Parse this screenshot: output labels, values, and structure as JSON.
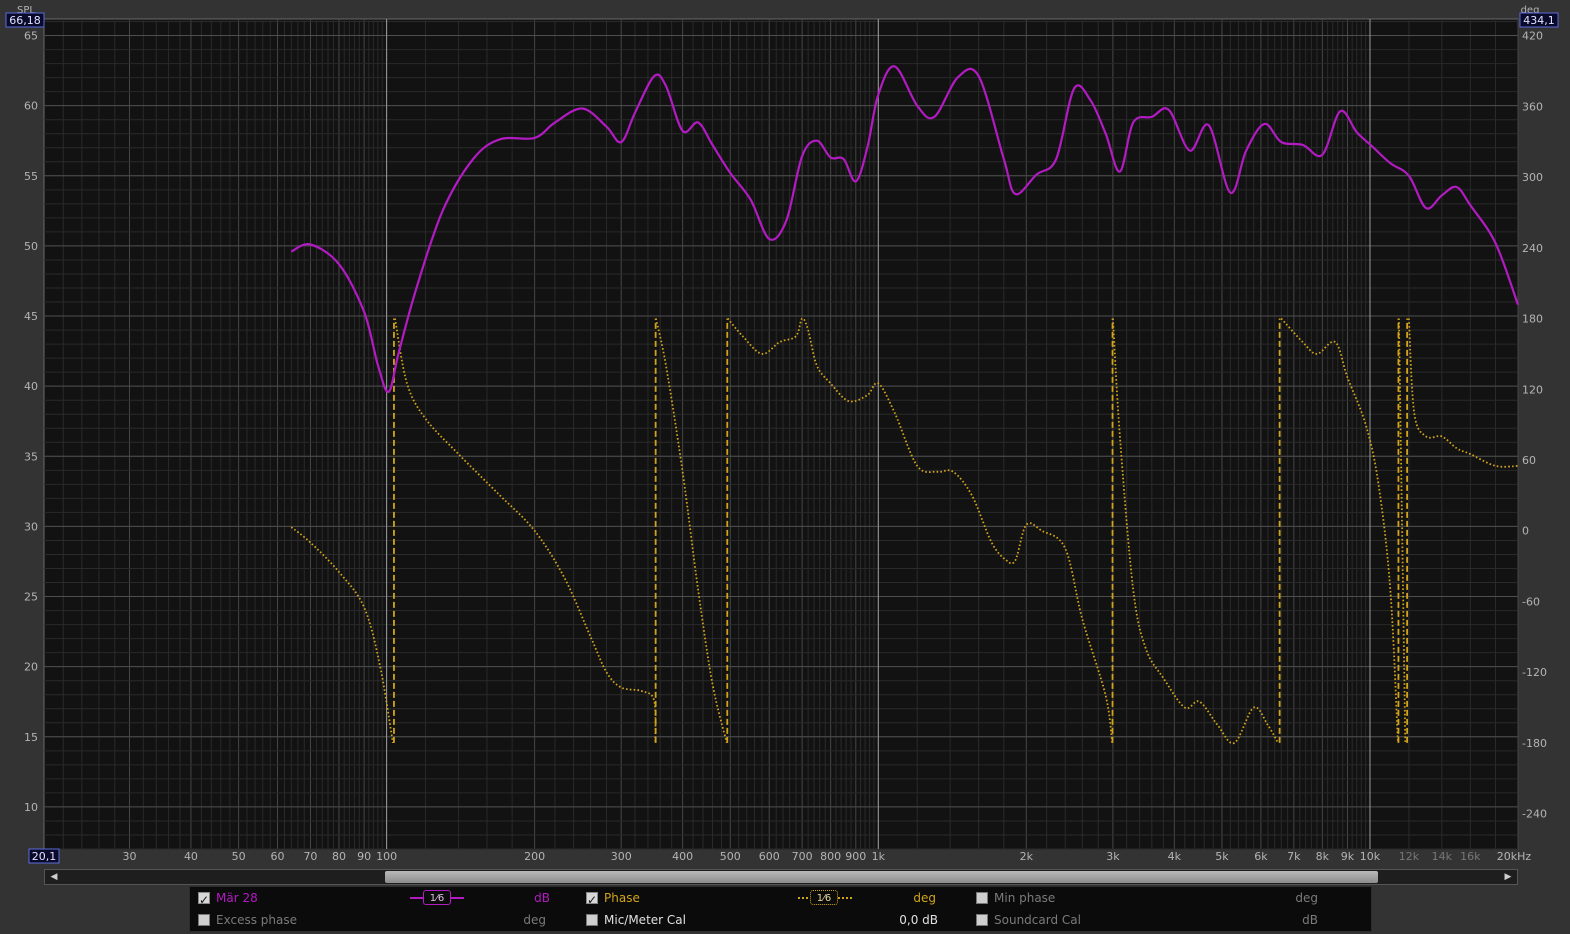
{
  "readouts": {
    "left_top": "66,18",
    "right_top": "434,1",
    "left_bottom": "20,1"
  },
  "axis_labels": {
    "left": "SPL",
    "right": "deg"
  },
  "colors": {
    "spl": "#b11bc1",
    "phase": "#d2a41a",
    "grid_major": "#464646",
    "grid_minor": "#2a2a2a",
    "plot_bg": "#121212"
  },
  "chart_data": {
    "type": "line",
    "x_scale": "log",
    "xlim": [
      20.1,
      20000
    ],
    "ylim_left": [
      7,
      66.18
    ],
    "ylim_right": [
      -270,
      434.1
    ],
    "grid": true,
    "x_tick_labels": [
      {
        "f": 30,
        "t": "30"
      },
      {
        "f": 40,
        "t": "40"
      },
      {
        "f": 50,
        "t": "50"
      },
      {
        "f": 60,
        "t": "60"
      },
      {
        "f": 70,
        "t": "70"
      },
      {
        "f": 80,
        "t": "80"
      },
      {
        "f": 90,
        "t": "90"
      },
      {
        "f": 100,
        "t": "100"
      },
      {
        "f": 200,
        "t": "200"
      },
      {
        "f": 300,
        "t": "300"
      },
      {
        "f": 400,
        "t": "400"
      },
      {
        "f": 500,
        "t": "500"
      },
      {
        "f": 600,
        "t": "600"
      },
      {
        "f": 700,
        "t": "700"
      },
      {
        "f": 800,
        "t": "800"
      },
      {
        "f": 900,
        "t": "900"
      },
      {
        "f": 1000,
        "t": "1k"
      },
      {
        "f": 2000,
        "t": "2k"
      },
      {
        "f": 3000,
        "t": "3k"
      },
      {
        "f": 4000,
        "t": "4k"
      },
      {
        "f": 5000,
        "t": "5k"
      },
      {
        "f": 6000,
        "t": "6k"
      },
      {
        "f": 7000,
        "t": "7k"
      },
      {
        "f": 8000,
        "t": "8k"
      },
      {
        "f": 9000,
        "t": "9k"
      },
      {
        "f": 10000,
        "t": "10k"
      },
      {
        "f": 12000,
        "t": "12k",
        "dim": true
      },
      {
        "f": 14000,
        "t": "14k",
        "dim": true
      },
      {
        "f": 16000,
        "t": "16k",
        "dim": true
      },
      {
        "f": 20000,
        "t": "20kHz"
      }
    ],
    "y_left_ticks": [
      65,
      60,
      55,
      50,
      45,
      40,
      35,
      30,
      25,
      20,
      15,
      10
    ],
    "y_right_ticks": [
      420,
      360,
      300,
      240,
      180,
      120,
      60,
      0,
      -60,
      -120,
      -180,
      -240
    ],
    "series": [
      {
        "name": "Mär 28",
        "axis": "left",
        "points": [
          [
            64,
            49.6
          ],
          [
            70,
            50.1
          ],
          [
            80,
            48.7
          ],
          [
            90,
            45.3
          ],
          [
            96,
            41.5
          ],
          [
            101,
            39.6
          ],
          [
            106,
            42.5
          ],
          [
            115,
            47
          ],
          [
            130,
            52.5
          ],
          [
            150,
            56.2
          ],
          [
            170,
            57.6
          ],
          [
            200,
            57.7
          ],
          [
            220,
            58.8
          ],
          [
            250,
            59.8
          ],
          [
            280,
            58.5
          ],
          [
            300,
            57.4
          ],
          [
            320,
            59.5
          ],
          [
            350,
            62.1
          ],
          [
            370,
            61.4
          ],
          [
            400,
            58.2
          ],
          [
            430,
            58.8
          ],
          [
            460,
            57.2
          ],
          [
            500,
            55.2
          ],
          [
            550,
            53.3
          ],
          [
            600,
            50.5
          ],
          [
            650,
            51.8
          ],
          [
            700,
            56.4
          ],
          [
            750,
            57.5
          ],
          [
            800,
            56.3
          ],
          [
            850,
            56.2
          ],
          [
            900,
            54.6
          ],
          [
            950,
            57
          ],
          [
            1000,
            60.8
          ],
          [
            1080,
            62.8
          ],
          [
            1200,
            60
          ],
          [
            1300,
            59.2
          ],
          [
            1450,
            62
          ],
          [
            1600,
            62.1
          ],
          [
            1800,
            56.2
          ],
          [
            1900,
            53.7
          ],
          [
            2100,
            55.1
          ],
          [
            2300,
            56.2
          ],
          [
            2500,
            61.2
          ],
          [
            2700,
            60.4
          ],
          [
            2900,
            58
          ],
          [
            3100,
            55.3
          ],
          [
            3300,
            58.8
          ],
          [
            3600,
            59.2
          ],
          [
            3900,
            59.7
          ],
          [
            4300,
            56.8
          ],
          [
            4700,
            58.6
          ],
          [
            5200,
            53.8
          ],
          [
            5600,
            56.8
          ],
          [
            6100,
            58.7
          ],
          [
            6600,
            57.4
          ],
          [
            7300,
            57.2
          ],
          [
            8000,
            56.5
          ],
          [
            8700,
            59.6
          ],
          [
            9400,
            58.1
          ],
          [
            10100,
            57.1
          ],
          [
            11000,
            55.9
          ],
          [
            12000,
            55
          ],
          [
            13000,
            52.7
          ],
          [
            14000,
            53.6
          ],
          [
            15000,
            54.2
          ],
          [
            16000,
            52.9
          ],
          [
            18000,
            50.2
          ],
          [
            20000,
            45.8
          ]
        ]
      },
      {
        "name": "Phase",
        "axis": "right",
        "segments": [
          [
            [
              64,
              3
            ],
            [
              70,
              -10
            ],
            [
              80,
              -35
            ],
            [
              90,
              -65
            ],
            [
              97,
              -115
            ],
            [
              103,
              -180
            ]
          ],
          [
            [
              104,
              180
            ],
            [
              110,
              125
            ],
            [
              120,
              95
            ],
            [
              140,
              65
            ],
            [
              170,
              30
            ],
            [
              200,
              0
            ],
            [
              230,
              -40
            ],
            [
              260,
              -90
            ],
            [
              280,
              -120
            ],
            [
              300,
              -133
            ],
            [
              330,
              -136
            ],
            [
              350,
              -144
            ],
            [
              352,
              -180
            ]
          ],
          [
            [
              353,
              180
            ],
            [
              370,
              140
            ],
            [
              400,
              50
            ],
            [
              430,
              -50
            ],
            [
              460,
              -130
            ],
            [
              492,
              -180
            ]
          ],
          [
            [
              494,
              180
            ],
            [
              530,
              165
            ],
            [
              580,
              150
            ],
            [
              630,
              160
            ],
            [
              680,
              165
            ],
            [
              700,
              180
            ],
            [
              720,
              170
            ],
            [
              750,
              140
            ],
            [
              800,
              125
            ],
            [
              870,
              110
            ],
            [
              950,
              115
            ],
            [
              1000,
              125
            ],
            [
              1080,
              100
            ],
            [
              1200,
              55
            ],
            [
              1320,
              50
            ],
            [
              1420,
              50
            ],
            [
              1550,
              30
            ],
            [
              1700,
              -10
            ],
            [
              1820,
              -25
            ],
            [
              1900,
              -25
            ],
            [
              2000,
              5
            ],
            [
              2150,
              0
            ],
            [
              2400,
              -15
            ],
            [
              2600,
              -75
            ],
            [
              2900,
              -140
            ],
            [
              2990,
              -180
            ]
          ],
          [
            [
              3000,
              180
            ],
            [
              3100,
              80
            ],
            [
              3300,
              -50
            ],
            [
              3500,
              -100
            ],
            [
              3800,
              -125
            ],
            [
              4200,
              -150
            ],
            [
              4500,
              -145
            ],
            [
              4900,
              -165
            ],
            [
              5300,
              -180
            ],
            [
              5800,
              -150
            ],
            [
              6200,
              -165
            ],
            [
              6500,
              -180
            ]
          ],
          [
            [
              6600,
              180
            ],
            [
              7300,
              160
            ],
            [
              7800,
              150
            ],
            [
              8500,
              160
            ],
            [
              9000,
              130
            ],
            [
              9800,
              90
            ],
            [
              10400,
              40
            ],
            [
              11000,
              -50
            ],
            [
              11400,
              -180
            ]
          ],
          [
            [
              11450,
              180
            ],
            [
              11800,
              -180
            ]
          ],
          [
            [
              12000,
              180
            ],
            [
              12300,
              100
            ],
            [
              13000,
              80
            ],
            [
              14000,
              80
            ],
            [
              15000,
              70
            ],
            [
              16000,
              65
            ],
            [
              18000,
              55
            ],
            [
              20000,
              55
            ]
          ]
        ]
      }
    ]
  },
  "scrollbar": {
    "left_arrow": "◀",
    "right_arrow": "▶"
  },
  "legend": {
    "spl": {
      "label": "Mär 28",
      "smoothing": "1⁄6",
      "unit": "dB",
      "checked": true
    },
    "phase": {
      "label": "Phase",
      "smoothing": "1⁄6",
      "unit": "deg",
      "checked": true
    },
    "min_phase": {
      "label": "Min phase",
      "unit": "deg",
      "checked": false
    },
    "excess_phase": {
      "label": "Excess phase",
      "unit": "deg",
      "checked": false
    },
    "mic_cal": {
      "label": "Mic/Meter Cal",
      "value": "0,0 dB",
      "checked": false
    },
    "soundcard_cal": {
      "label": "Soundcard Cal",
      "unit": "dB",
      "checked": false
    }
  }
}
